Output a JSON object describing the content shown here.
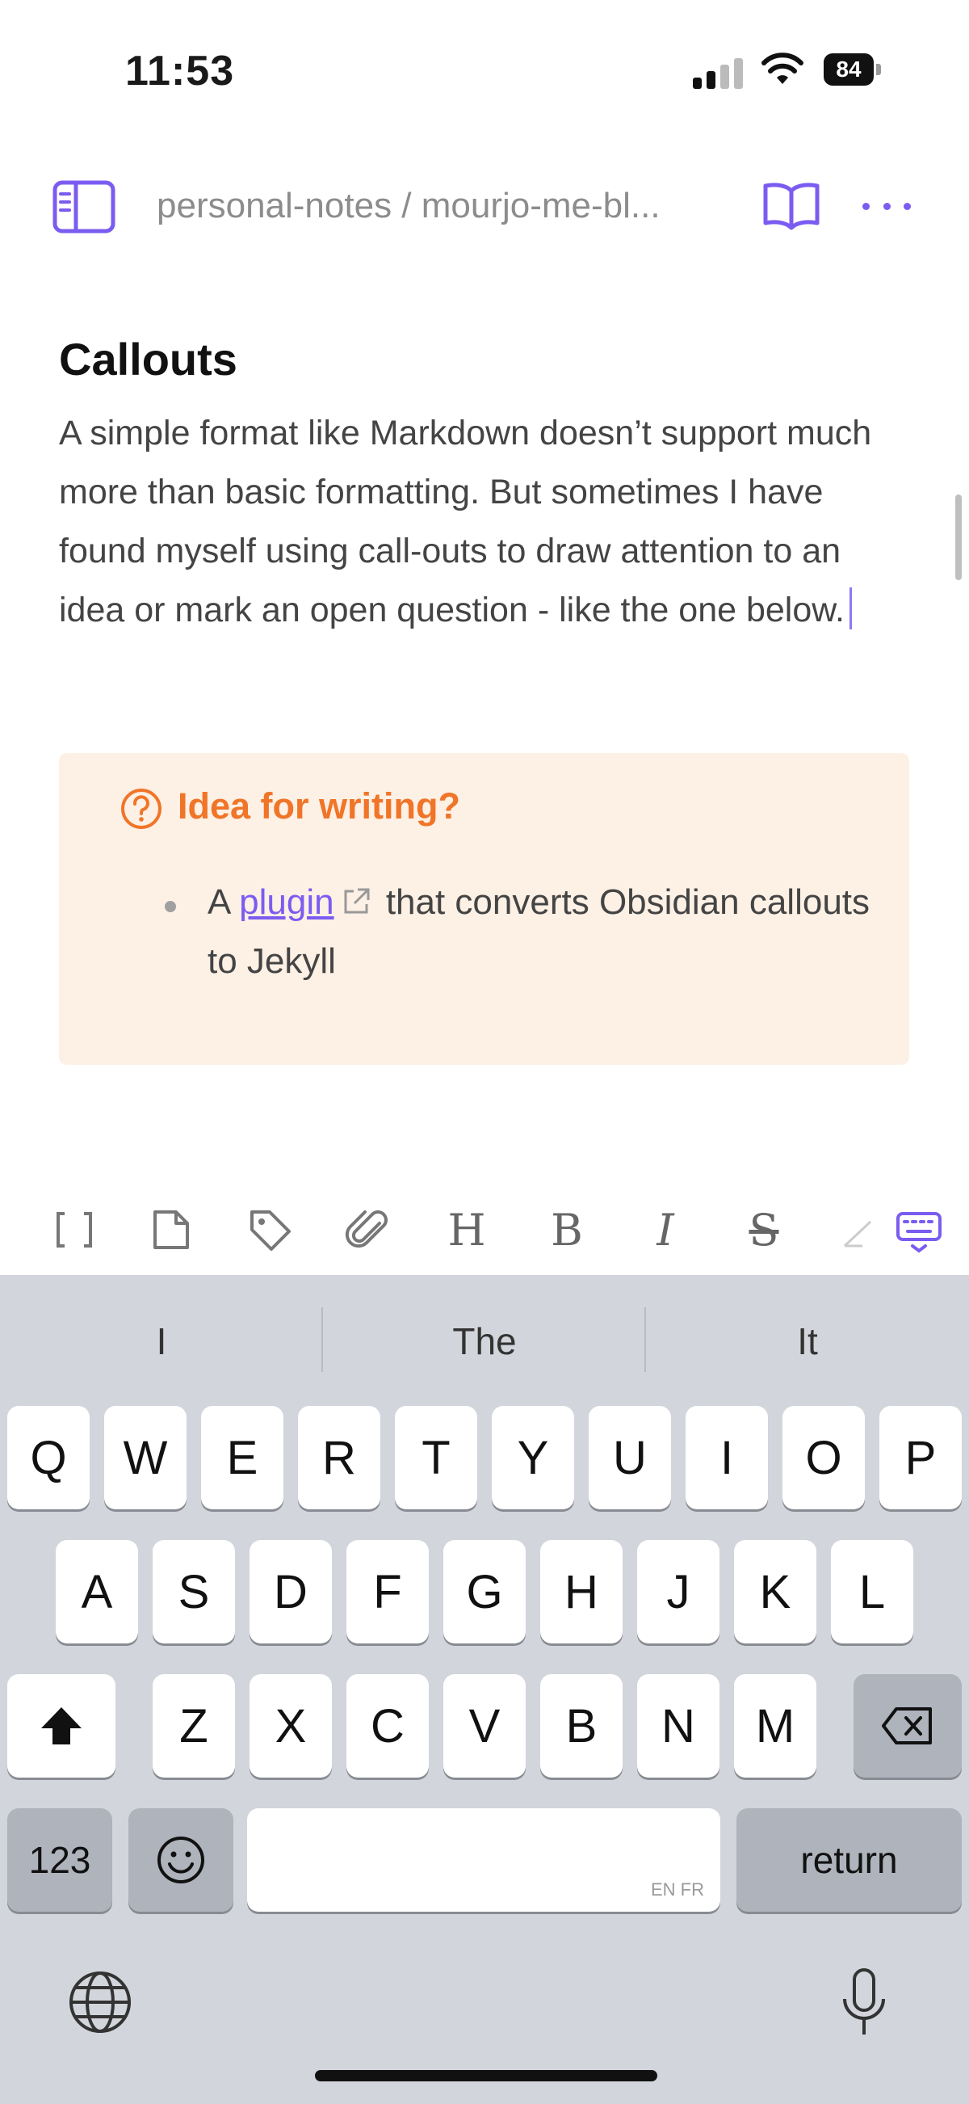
{
  "status_bar": {
    "time": "11:53",
    "battery": "84"
  },
  "nav": {
    "breadcrumb": "personal-notes / mourjo-me-bl...",
    "accent_color": "#7b5cf0"
  },
  "content": {
    "heading": "Callouts",
    "paragraph": "A simple format like Markdown doesn’t support much more than basic formatting. But sometimes I have found myself using call-outs to draw attention to an idea or mark an open question - like the one below.",
    "callout": {
      "icon": "question-circle-icon",
      "title": "Idea for writing?",
      "bullet_prefix": "A ",
      "link_text": "plugin",
      "bullet_suffix": " that converts Obsidian callouts to Jekyll",
      "title_color": "#f07528",
      "background": "#fdf0e5"
    }
  },
  "toolbar": {
    "items": [
      "brackets-icon",
      "file-icon",
      "tag-icon",
      "paperclip-icon",
      "heading-icon",
      "bold-icon",
      "italic-icon",
      "strikethrough-icon",
      "highlighter-icon",
      "keyboard-dismiss-icon"
    ],
    "heading_glyph": "H",
    "bold_glyph": "B",
    "italic_glyph": "I",
    "strike_glyph": "S"
  },
  "keyboard": {
    "suggestions": [
      "I",
      "The",
      "It"
    ],
    "row1": [
      "Q",
      "W",
      "E",
      "R",
      "T",
      "Y",
      "U",
      "I",
      "O",
      "P"
    ],
    "row2": [
      "A",
      "S",
      "D",
      "F",
      "G",
      "H",
      "J",
      "K",
      "L"
    ],
    "row3": [
      "Z",
      "X",
      "C",
      "V",
      "B",
      "N",
      "M"
    ],
    "numbers_label": "123",
    "return_label": "return",
    "space_lang": "EN FR"
  }
}
